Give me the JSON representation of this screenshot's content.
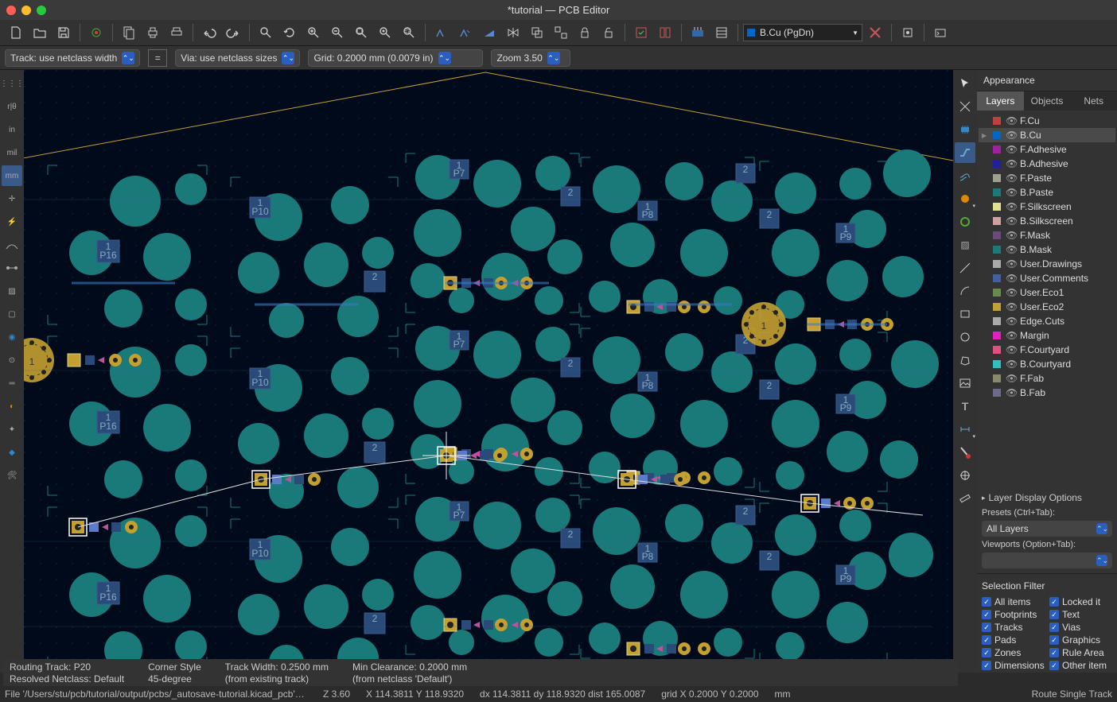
{
  "window": {
    "title": "*tutorial — PCB Editor"
  },
  "toolbar2": {
    "track": "Track: use netclass width",
    "via": "Via: use netclass sizes",
    "grid": "Grid: 0.2000 mm (0.0079 in)",
    "zoom": "Zoom 3.50"
  },
  "layer_selector": {
    "value": "B.Cu (PgDn)"
  },
  "appearance": {
    "title": "Appearance",
    "tabs": [
      "Layers",
      "Objects",
      "Nets"
    ],
    "layers": [
      {
        "name": "F.Cu",
        "color": "#c04040"
      },
      {
        "name": "B.Cu",
        "color": "#0066cc",
        "selected": true,
        "arrow": true
      },
      {
        "name": "F.Adhesive",
        "color": "#a020a0"
      },
      {
        "name": "B.Adhesive",
        "color": "#2020a0"
      },
      {
        "name": "F.Paste",
        "color": "#a0a090"
      },
      {
        "name": "B.Paste",
        "color": "#1a7a7a"
      },
      {
        "name": "F.Silkscreen",
        "color": "#e0e090"
      },
      {
        "name": "B.Silkscreen",
        "color": "#d0a0a0"
      },
      {
        "name": "F.Mask",
        "color": "#6a4a7a"
      },
      {
        "name": "B.Mask",
        "color": "#1a7a7a"
      },
      {
        "name": "User.Drawings",
        "color": "#aaa"
      },
      {
        "name": "User.Comments",
        "color": "#4060a0"
      },
      {
        "name": "User.Eco1",
        "color": "#6a8a4a"
      },
      {
        "name": "User.Eco2",
        "color": "#c4a030"
      },
      {
        "name": "Edge.Cuts",
        "color": "#aaa"
      },
      {
        "name": "Margin",
        "color": "#e020c0"
      },
      {
        "name": "F.Courtyard",
        "color": "#e05080"
      },
      {
        "name": "B.Courtyard",
        "color": "#30c0c0"
      },
      {
        "name": "F.Fab",
        "color": "#8a8a6a"
      },
      {
        "name": "B.Fab",
        "color": "#6a6a8a"
      }
    ],
    "layer_display": "Layer Display Options",
    "presets_label": "Presets (Ctrl+Tab):",
    "presets_value": "All Layers",
    "viewports_label": "Viewports (Option+Tab):",
    "viewports_value": ""
  },
  "selection_filter": {
    "title": "Selection Filter",
    "items_left": [
      "All items",
      "Footprints",
      "Tracks",
      "Pads",
      "Zones",
      "Dimensions"
    ],
    "items_right": [
      "Locked it",
      "Text",
      "Vias",
      "Graphics",
      "Rule Area",
      "Other item"
    ]
  },
  "status_info": {
    "routing_track": "Routing Track: P20",
    "resolved_netclass": "Resolved Netclass: Default",
    "corner_style_label": "Corner Style",
    "corner_style_value": "45-degree",
    "track_width_label": "Track Width: 0.2500 mm",
    "track_width_value": "(from existing track)",
    "min_clearance_label": "Min Clearance: 0.2000 mm",
    "min_clearance_value": "(from netclass 'Default')"
  },
  "status_bar": {
    "file": "File '/Users/stu/pcb/tutorial/output/pcbs/_autosave-tutorial.kicad_pcb' sa…",
    "z": "Z 3.60",
    "xy": "X 114.3811  Y 118.9320",
    "dxy": "dx 114.3811  dy 118.9320  dist 165.0087",
    "grid": "grid X 0.2000  Y 0.2000",
    "units": "mm",
    "mode": "Route Single Track"
  }
}
